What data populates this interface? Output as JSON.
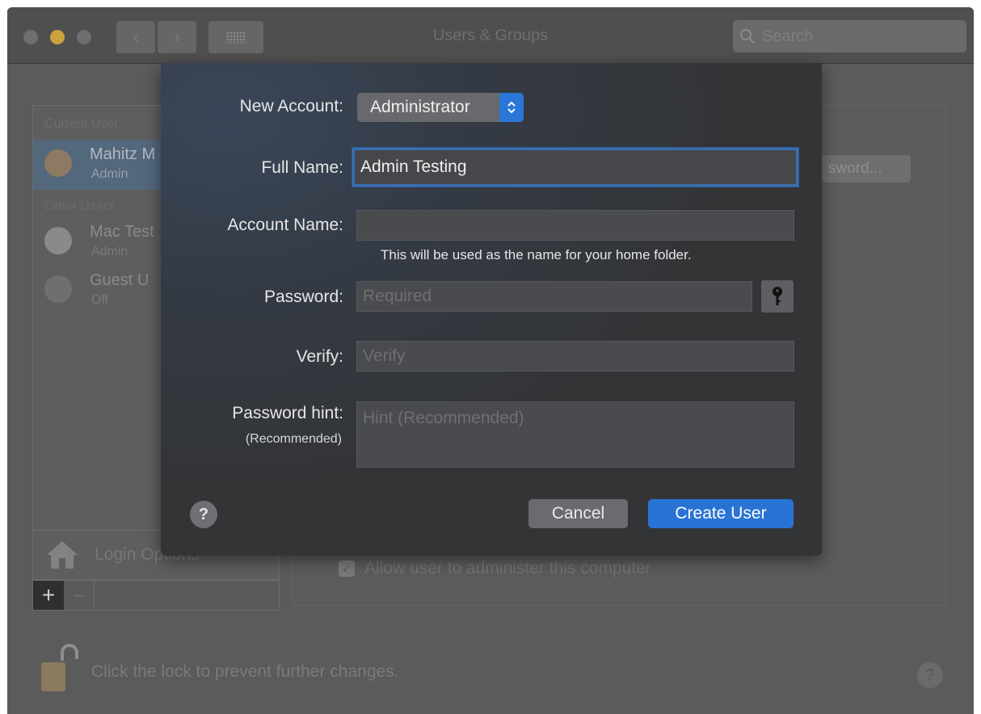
{
  "window": {
    "title": "Users & Groups",
    "search_placeholder": "Search"
  },
  "sidebar": {
    "current_user_label": "Current User",
    "other_users_label": "Other Users",
    "users": [
      {
        "name": "Mahitz M",
        "role": "Admin",
        "selected": true
      },
      {
        "name": "Mac Test",
        "role": "Admin",
        "selected": false
      },
      {
        "name": "Guest U",
        "role": "Off",
        "selected": false
      }
    ],
    "login_options": "Login Options",
    "add_symbol": "+",
    "remove_symbol": "−"
  },
  "right_panel": {
    "password_button": "Change Password...",
    "password_button_visible": "sword...",
    "allow_admin_label": "Allow user to administer this computer"
  },
  "footer": {
    "lock_text": "Click the lock to prevent further changes.",
    "help": "?"
  },
  "sheet": {
    "new_account_label": "New Account:",
    "account_type": "Administrator",
    "full_name_label": "Full Name:",
    "full_name_value": "Admin Testing",
    "account_name_label": "Account Name:",
    "account_name_value": "",
    "home_folder_note": "This will be used as the name for your home folder.",
    "password_label": "Password:",
    "password_placeholder": "Required",
    "verify_label": "Verify:",
    "verify_placeholder": "Verify",
    "hint_label": "Password hint:",
    "hint_sublabel": "(Recommended)",
    "hint_placeholder": "Hint (Recommended)",
    "help": "?",
    "cancel_label": "Cancel",
    "create_label": "Create User"
  },
  "colors": {
    "accent": "#2a73d6",
    "sheet_bg": "#333436",
    "window_bg": "#5b5b5b"
  }
}
